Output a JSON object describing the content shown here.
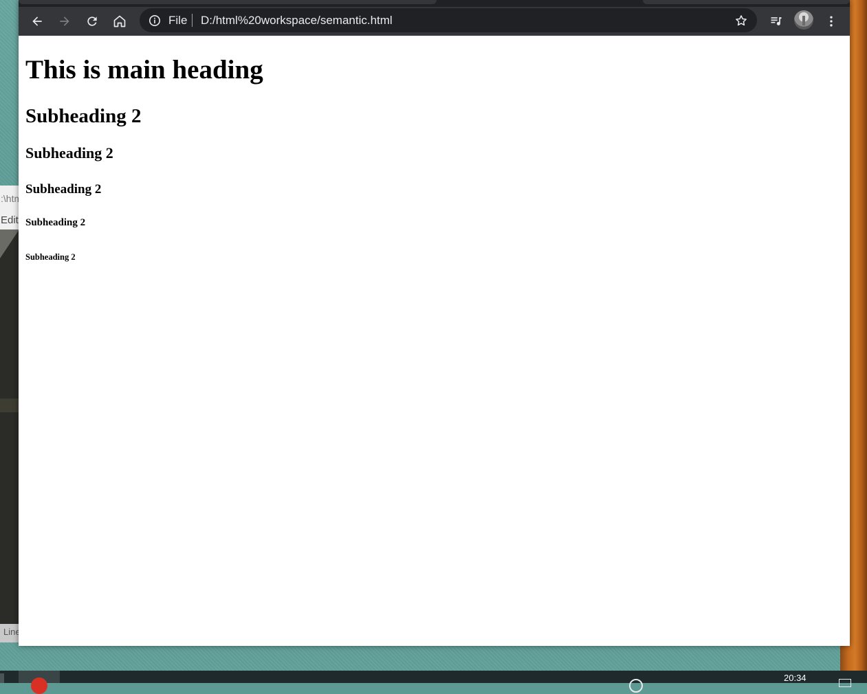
{
  "browser": {
    "omnibox": {
      "scheme": "File",
      "url": "D:/html%20workspace/semantic.html"
    }
  },
  "page": {
    "h1": "This is main heading",
    "h2": "Subheading 2",
    "h3": "Subheading 2",
    "h4": "Subheading 2",
    "h5": "Subheading 2",
    "h6": "Subheading 2"
  },
  "background_editor": {
    "path": ":\\htm",
    "menu": "Edit",
    "status": "Line"
  },
  "taskbar": {
    "clock": "20:34"
  },
  "colors": {
    "toolbar": "#35363a",
    "omnibox": "#202124",
    "tabstrip": "#202124",
    "desktop": "#5e9a94",
    "page_background": "#ffffff"
  }
}
